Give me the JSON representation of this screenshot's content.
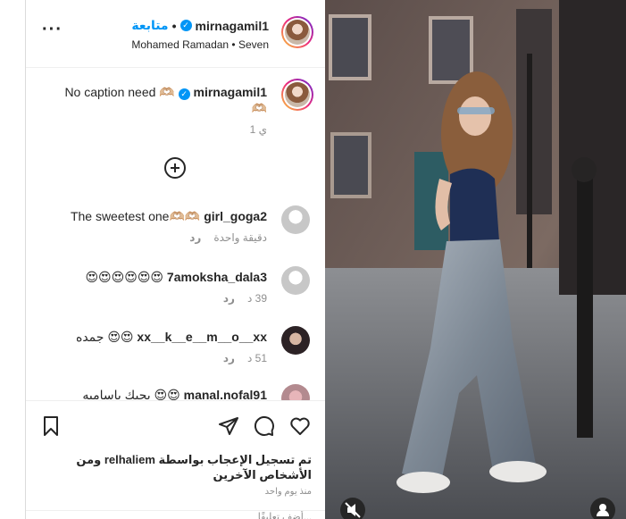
{
  "header": {
    "username": "mirnagamil1",
    "follow_label": "متابعة",
    "audio": "Mohamed Ramadan • Seven",
    "more_label": "···"
  },
  "caption": {
    "text": "No caption need 🫶🏼",
    "username": "mirnagamil1",
    "extra": "🫶🏼",
    "time": "1 ي"
  },
  "comments": [
    {
      "username": "girl_goga2",
      "text": "The sweetest one🫶🏼🫶🏼",
      "time": "دقيقة واحدة",
      "reply": "رد"
    },
    {
      "username": "7amoksha_dala3",
      "text": "😍😍😍😍😍😍",
      "time": "39 د",
      "reply": "رد"
    },
    {
      "username": "xx__k__e__m__o__xx",
      "text": "جمده 😍😍",
      "time": "51 د",
      "reply": "رد"
    },
    {
      "username": "manal.nofal91",
      "text": "بحبك باسامبه 😍😍",
      "time": "",
      "reply": ""
    }
  ],
  "actions": {
    "liked_by": "تم تسجيل الإعجاب بواسطة relhaliem ومن الأشخاص الآخرين",
    "posted_ago": "منذ يوم واحد",
    "add_comment_placeholder": "أضف تعليقًا..."
  },
  "colors": {
    "accent": "#0095f6",
    "text": "#262626",
    "muted": "#8e8e8e",
    "border": "#dbdbdb"
  }
}
